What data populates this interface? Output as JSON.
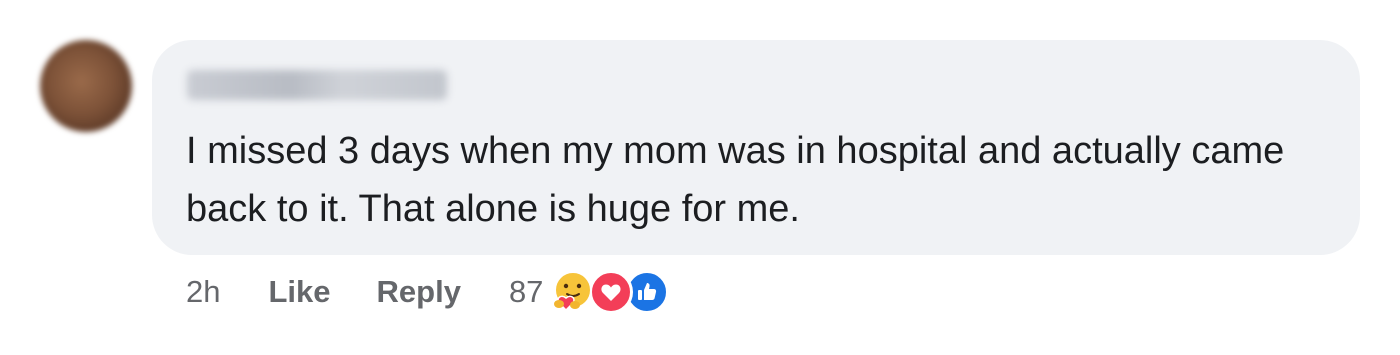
{
  "comment": {
    "author": "",
    "text": "I missed 3 days when my mom was in hospital and actually came back to it. That alone is huge for me.",
    "timestamp": "2h",
    "like_label": "Like",
    "reply_label": "Reply",
    "reaction_count": "87",
    "reactions": [
      "care-icon",
      "love-icon",
      "like-icon"
    ]
  },
  "colors": {
    "bubble_bg": "#f0f2f5",
    "text": "#1c1e21",
    "meta": "#65676b",
    "love": "#f33e58",
    "like": "#1b74e4"
  }
}
